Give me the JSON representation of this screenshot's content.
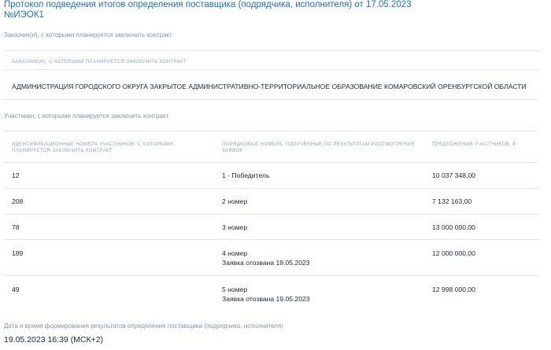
{
  "header": {
    "title_line1": "Протокол подведения итогов определения поставщика (подрядчика, исполнителя) от 17.05.2023",
    "title_line2": "№ИЭОК1"
  },
  "customers": {
    "section_label": "Заказчик(и), с которыми планируется заключить контракт",
    "column_header": "Заказчик(и), с которыми планируется заключить контракт",
    "name": "АДМИНИСТРАЦИЯ ГОРОДСКОГО ОКРУГА ЗАКРЫТОЕ АДМИНИСТРАТИВНО-ТЕРРИТОРИАЛЬНОЕ ОБРАЗОВАНИЕ КОМАРОВСКИЙ ОРЕНБУРГСКОЙ ОБЛАСТИ"
  },
  "participants": {
    "section_label": "Участники, с которыми планируется заключить контракт",
    "headers": {
      "id_line1": "Идентификационные номера участников, с которыми",
      "id_line2": "планируется заключить контракт",
      "rank_line1": "Порядковые номера, полученные по результатам рассмотрения",
      "rank_line2": "заявок",
      "offer": "Предложения участников, ₽"
    },
    "rows": [
      {
        "id": "12",
        "rank": "1 - Победитель",
        "note": "",
        "offer": "10 037 348,00"
      },
      {
        "id": "208",
        "rank": "2 номер",
        "note": "",
        "offer": "7 132 163,00"
      },
      {
        "id": "78",
        "rank": "3 номер",
        "note": "",
        "offer": "13 000 000,00"
      },
      {
        "id": "189",
        "rank": "4 номер",
        "note": "Заявка отозвана 19.05.2023",
        "offer": "12 000 000,00"
      },
      {
        "id": "49",
        "rank": "5 номер",
        "note": "Заявка отозвана 19.05.2023",
        "offer": "12 998 000,00"
      }
    ]
  },
  "results": {
    "label": "Дата и время формирования результатов определения поставщика (подрядчика, исполнителя)",
    "value": "19.05.2023 16:39 (МСК+2)"
  }
}
